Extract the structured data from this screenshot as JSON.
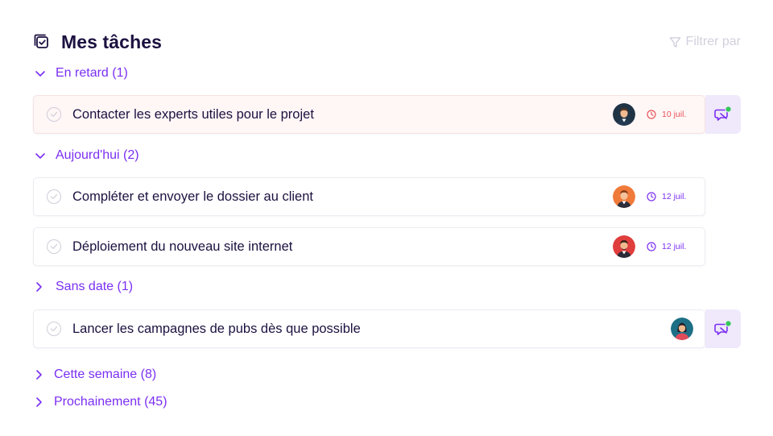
{
  "header": {
    "title": "Mes tâches",
    "filter_label": "Filtrer par"
  },
  "sections": [
    {
      "label": "En retard (1)",
      "expanded": true,
      "tasks": [
        {
          "label": "Contacter les experts utiles pour le projet",
          "due": "10 juil.",
          "status": "late",
          "avatar": "man-dark-hair",
          "has_chat": true
        }
      ]
    },
    {
      "label": "Aujourd'hui (2)",
      "expanded": true,
      "tasks": [
        {
          "label": "Compléter et envoyer le dossier au client",
          "due": "12 juil.",
          "status": "ok",
          "avatar": "man-orange",
          "has_chat": false
        },
        {
          "label": "Déploiement du nouveau site internet",
          "due": "12 juil.",
          "status": "ok",
          "avatar": "man-red",
          "has_chat": false
        }
      ]
    },
    {
      "label": "Sans date (1)",
      "expanded": false,
      "tasks": [
        {
          "label": "Lancer les campagnes de pubs dès que possible",
          "due": "",
          "status": "none",
          "avatar": "woman-teal",
          "has_chat": true
        }
      ]
    },
    {
      "label": "Cette semaine (8)",
      "expanded": false,
      "tasks": []
    },
    {
      "label": "Prochainement (45)",
      "expanded": false,
      "tasks": []
    }
  ],
  "colors": {
    "accent": "#7b2ff2",
    "late": "#e8545a",
    "online": "#34c759",
    "chat_bg": "#efe9fb"
  },
  "icons": {
    "title": "task-list-icon",
    "filter": "filter-icon",
    "chevron_open": "chevron-down-icon",
    "chevron_closed": "chevron-right-icon",
    "due": "clock-icon",
    "chat": "chat-bubble-icon"
  }
}
